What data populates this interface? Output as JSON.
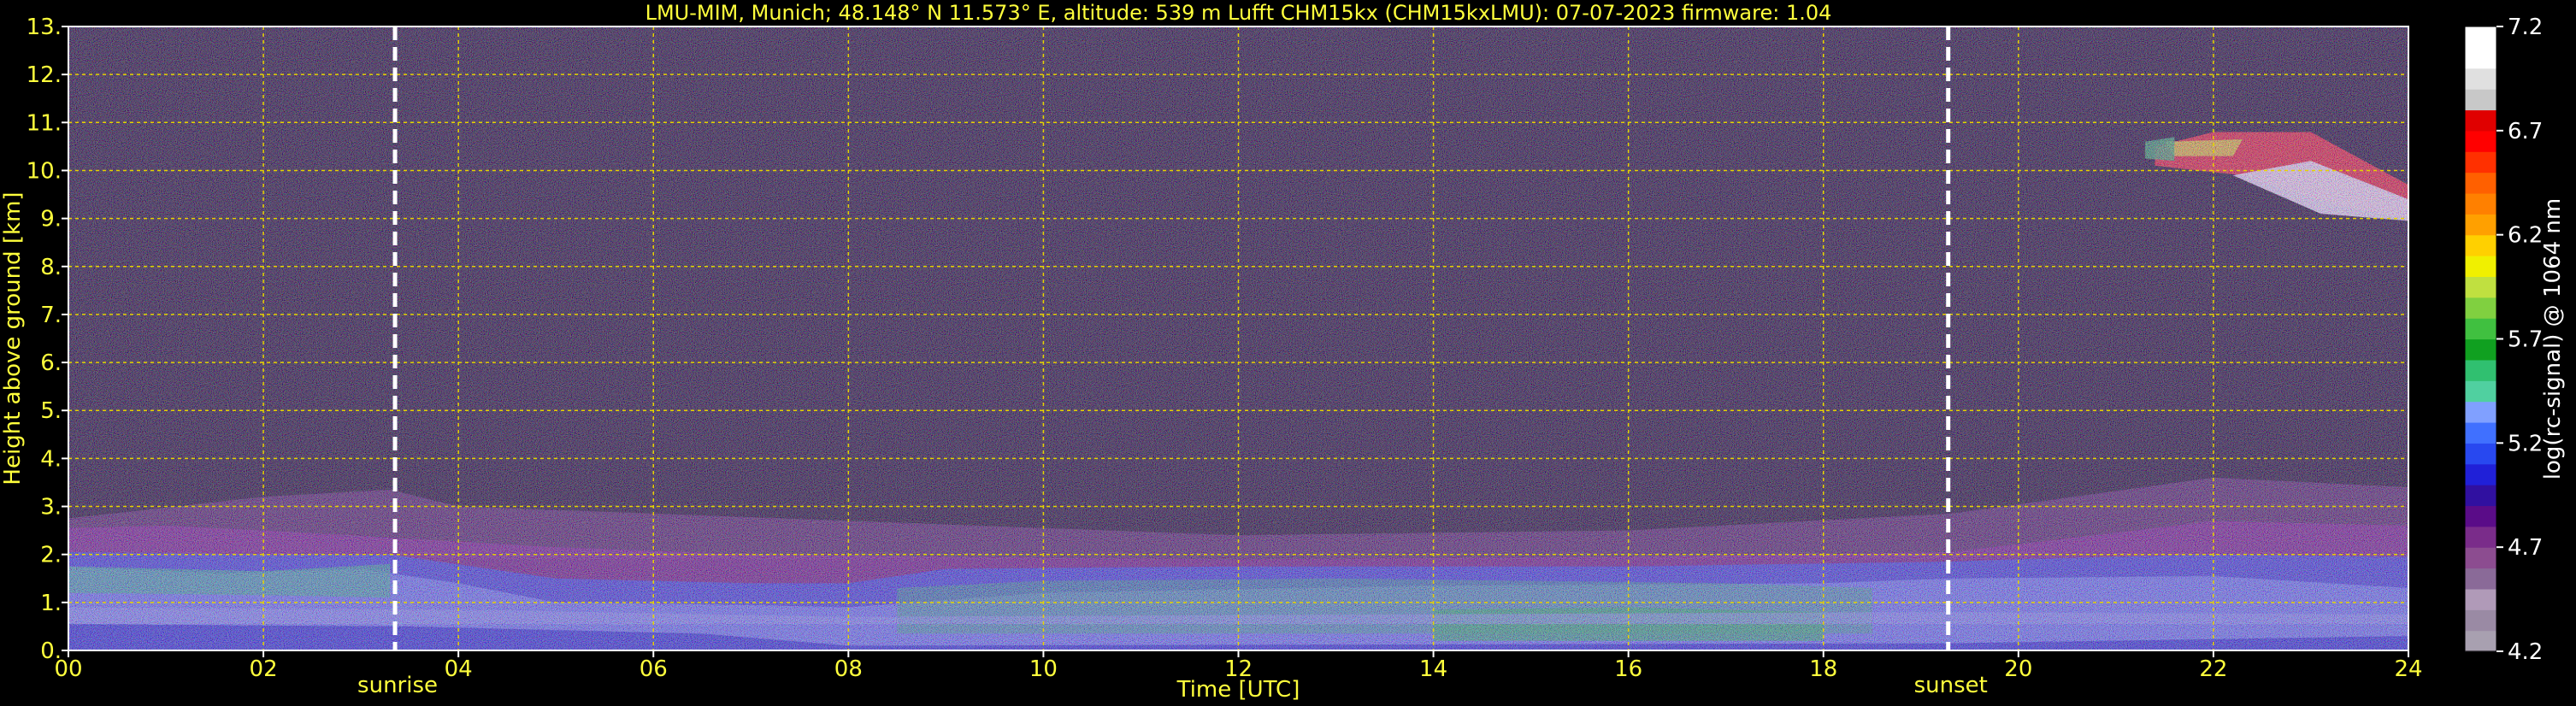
{
  "chart_data": {
    "type": "heatmap",
    "title": "LMU-MIM, Munich; 48.148° N 11.573° E, altitude: 539 m    Lufft CHM15kx (CHM15kxLMU): 07-07-2023    firmware: 1.04",
    "xlabel": "Time [UTC]",
    "ylabel": "Height above ground [km]",
    "xlim": [
      0,
      24
    ],
    "ylim": [
      0,
      13
    ],
    "x_ticks": [
      "00",
      "02",
      "04",
      "06",
      "08",
      "10",
      "12",
      "14",
      "16",
      "18",
      "20",
      "22",
      "24"
    ],
    "y_ticks": [
      "0.",
      "1.",
      "2.",
      "3.",
      "4.",
      "5.",
      "6.",
      "7.",
      "8.",
      "9.",
      "10.",
      "11.",
      "12.",
      "13."
    ],
    "grid": true,
    "markers": [
      {
        "label": "sunrise",
        "time": 3.35
      },
      {
        "label": "sunset",
        "time": 19.28
      }
    ],
    "colorbar": {
      "label": "log(rc-signal) @ 1064 nm",
      "range": [
        4.2,
        7.2
      ],
      "ticks": [
        "4.2",
        "4.7",
        "5.2",
        "5.7",
        "6.2",
        "6.7",
        "7.2"
      ],
      "colors": [
        "#a8a0b0",
        "#9a8aa4",
        "#b09ab8",
        "#8a6a98",
        "#8c4c90",
        "#7a2c8a",
        "#5a0c88",
        "#3010a0",
        "#2020d8",
        "#2848f0",
        "#4070ff",
        "#80a0ff",
        "#50d0a0",
        "#30c070",
        "#10a020",
        "#40c040",
        "#80d040",
        "#c0e040",
        "#f0f000",
        "#ffd000",
        "#ffa000",
        "#ff8000",
        "#ff6000",
        "#ff3000",
        "#ff0000",
        "#e00000",
        "#c8c8c8",
        "#e0e0e0",
        "#ffffff",
        "#ffffff"
      ]
    }
  },
  "colors": {
    "text": "#ffff3c",
    "grid": "#e6d200",
    "colorbar_text": "#ffffff",
    "background": "#000000"
  }
}
